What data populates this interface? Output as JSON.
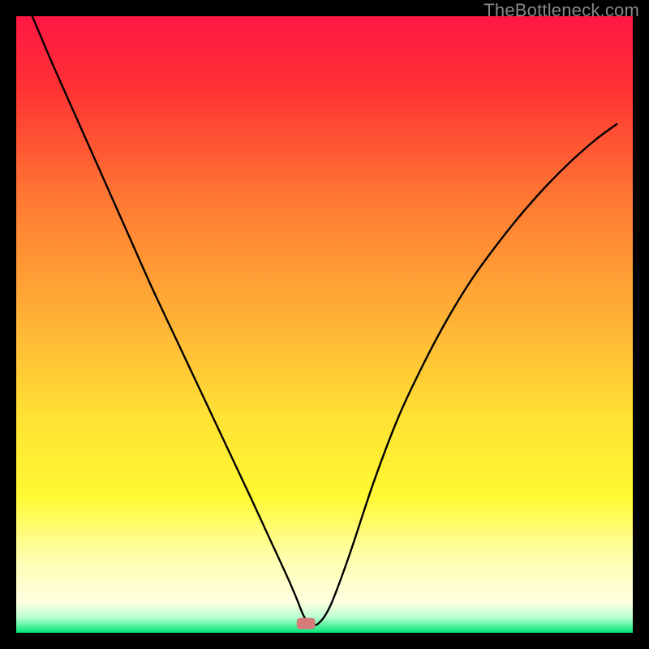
{
  "watermark": "TheBottleneck.com",
  "chart_data": {
    "type": "line",
    "title": "",
    "xlabel": "",
    "ylabel": "",
    "xlim": [
      0,
      100
    ],
    "ylim": [
      0,
      100
    ],
    "grid": false,
    "gradient_colors": [
      {
        "offset": 0.0,
        "color": "#ff1744"
      },
      {
        "offset": 0.12,
        "color": "#ff3333"
      },
      {
        "offset": 0.3,
        "color": "#ff7a33"
      },
      {
        "offset": 0.5,
        "color": "#ffb436"
      },
      {
        "offset": 0.65,
        "color": "#ffe233"
      },
      {
        "offset": 0.78,
        "color": "#fff933"
      },
      {
        "offset": 0.88,
        "color": "#ffffb0"
      },
      {
        "offset": 0.95,
        "color": "#ffffe0"
      },
      {
        "offset": 0.975,
        "color": "#baffcf"
      },
      {
        "offset": 1.0,
        "color": "#00e676"
      }
    ],
    "series": [
      {
        "name": "bottleneck-curve",
        "x": [
          2.6,
          6.0,
          10.0,
          14.0,
          18.0,
          22.0,
          26.0,
          30.0,
          34.0,
          38.0,
          41.0,
          44.0,
          45.5,
          46.5,
          47.5,
          49.0,
          51.0,
          54.0,
          58.0,
          62.0,
          66.0,
          70.0,
          74.0,
          78.0,
          82.0,
          86.0,
          90.0,
          94.0,
          97.4
        ],
        "y": [
          100.0,
          92.0,
          83.0,
          74.0,
          65.0,
          56.0,
          47.5,
          39.0,
          30.5,
          22.0,
          15.5,
          9.0,
          5.5,
          3.0,
          1.5,
          1.5,
          4.5,
          12.5,
          24.5,
          35.0,
          43.5,
          51.0,
          57.5,
          63.0,
          68.0,
          72.5,
          76.5,
          80.0,
          82.5
        ]
      }
    ],
    "marker": {
      "x": 47.0,
      "y": 1.5,
      "color": "#d67a7a",
      "w": 3.0,
      "h": 1.8
    }
  }
}
